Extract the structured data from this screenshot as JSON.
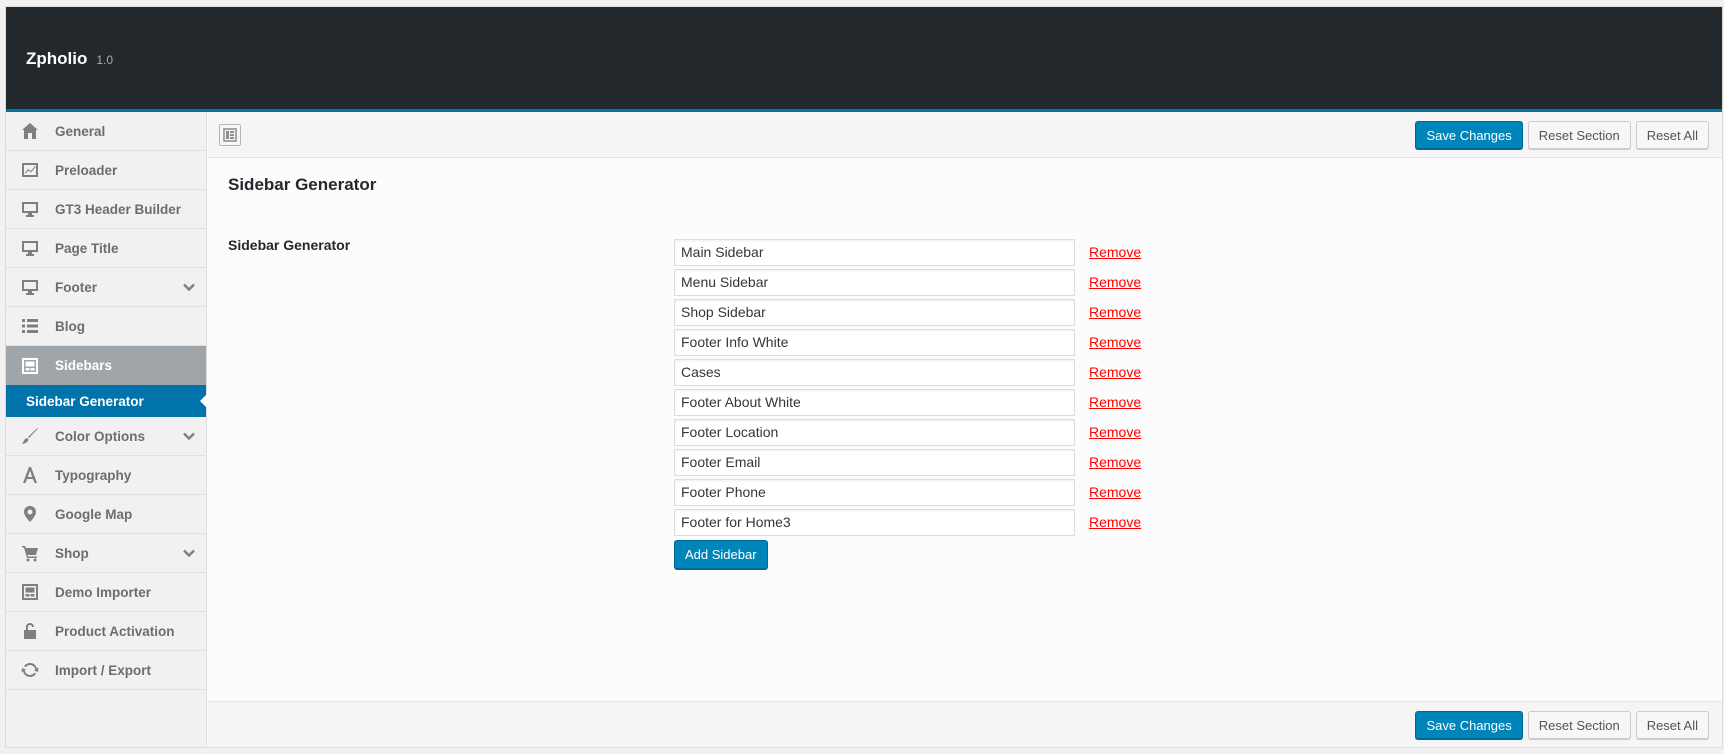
{
  "app": {
    "name": "Zpholio",
    "version": "1.0"
  },
  "sidebar": {
    "items": [
      {
        "label": "General",
        "icon": "home-icon",
        "chevron": false
      },
      {
        "label": "Preloader",
        "icon": "chart-icon",
        "chevron": false
      },
      {
        "label": "GT3 Header Builder",
        "icon": "desktop-icon",
        "chevron": false
      },
      {
        "label": "Page Title",
        "icon": "desktop-icon",
        "chevron": false
      },
      {
        "label": "Footer",
        "icon": "desktop-icon",
        "chevron": true
      },
      {
        "label": "Blog",
        "icon": "list-icon",
        "chevron": false
      },
      {
        "label": "Sidebars",
        "icon": "layout-icon",
        "chevron": false,
        "active": true
      },
      {
        "label": "Color Options",
        "icon": "brush-icon",
        "chevron": true
      },
      {
        "label": "Typography",
        "icon": "font-icon",
        "chevron": false
      },
      {
        "label": "Google Map",
        "icon": "location-icon",
        "chevron": false
      },
      {
        "label": "Shop",
        "icon": "cart-icon",
        "chevron": true
      },
      {
        "label": "Demo Importer",
        "icon": "layout-icon",
        "chevron": false
      },
      {
        "label": "Product Activation",
        "icon": "unlock-icon",
        "chevron": false
      },
      {
        "label": "Import / Export",
        "icon": "refresh-icon",
        "chevron": false
      }
    ],
    "sub_item": "Sidebar Generator"
  },
  "toolbar": {
    "save_label": "Save Changes",
    "reset_section_label": "Reset Section",
    "reset_all_label": "Reset All"
  },
  "section": {
    "title": "Sidebar Generator",
    "field_label": "Sidebar Generator",
    "sidebars": [
      "Main Sidebar",
      "Menu Sidebar",
      "Shop Sidebar",
      "Footer Info White",
      "Cases",
      "Footer About White",
      "Footer Location",
      "Footer Email",
      "Footer Phone",
      "Footer for Home3"
    ],
    "remove_label": "Remove",
    "add_label": "Add Sidebar"
  },
  "colors": {
    "accent": "#0073aa",
    "button": "#0085ba",
    "header_bg": "#23282d",
    "remove": "#ff0000"
  }
}
